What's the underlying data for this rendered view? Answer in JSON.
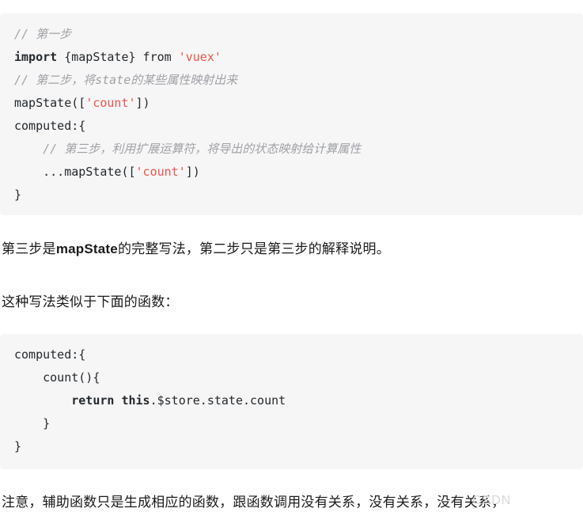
{
  "document": {
    "background_color": "#ffffff",
    "code_block_background": "#f6f6f6",
    "comment_color": "#a0a1a7",
    "string_color": "#e8554d",
    "text_color": "#1a1a1a"
  },
  "code_block_1": {
    "language": "javascript",
    "lines": [
      {
        "id": "l1",
        "comment": "// 第一步"
      },
      {
        "id": "l2",
        "keyword": "import",
        "plain_a": " {mapState} from ",
        "string": "'vuex'"
      },
      {
        "id": "l3",
        "comment": "// 第二步，将state的某些属性映射出来"
      },
      {
        "id": "l4",
        "plain_a": "mapState([",
        "string": "'count'",
        "plain_b": "])"
      },
      {
        "id": "l5",
        "plain_a": "computed:{"
      },
      {
        "id": "l6",
        "comment": "    // 第三步，利用扩展运算符，将导出的状态映射给计算属性"
      },
      {
        "id": "l7",
        "plain_a": "    ...mapState([",
        "string": "'count'",
        "plain_b": "])"
      },
      {
        "id": "l8",
        "plain_a": "}"
      }
    ]
  },
  "code_block_2": {
    "language": "javascript",
    "lines": [
      {
        "id": "m1",
        "plain_a": "computed:{"
      },
      {
        "id": "m2",
        "plain_a": "    count(){"
      },
      {
        "id": "m3",
        "plain_a": "        ",
        "keyword": "return this",
        "plain_b": ".$store.state.count"
      },
      {
        "id": "m4",
        "plain_a": "    }"
      },
      {
        "id": "m5",
        "plain_a": "}"
      }
    ]
  },
  "paragraphs": {
    "p1_before": "第三步是",
    "p1_bold": "mapState",
    "p1_after": "的完整写法，第二步只是第三步的解释说明。",
    "p2": "这种写法类似于下面的函数：",
    "p3": "注意，辅助函数只是生成相应的函数，跟函数调用没有关系，没有关系，没有关系，"
  },
  "watermark": {
    "text": "CSDN"
  }
}
